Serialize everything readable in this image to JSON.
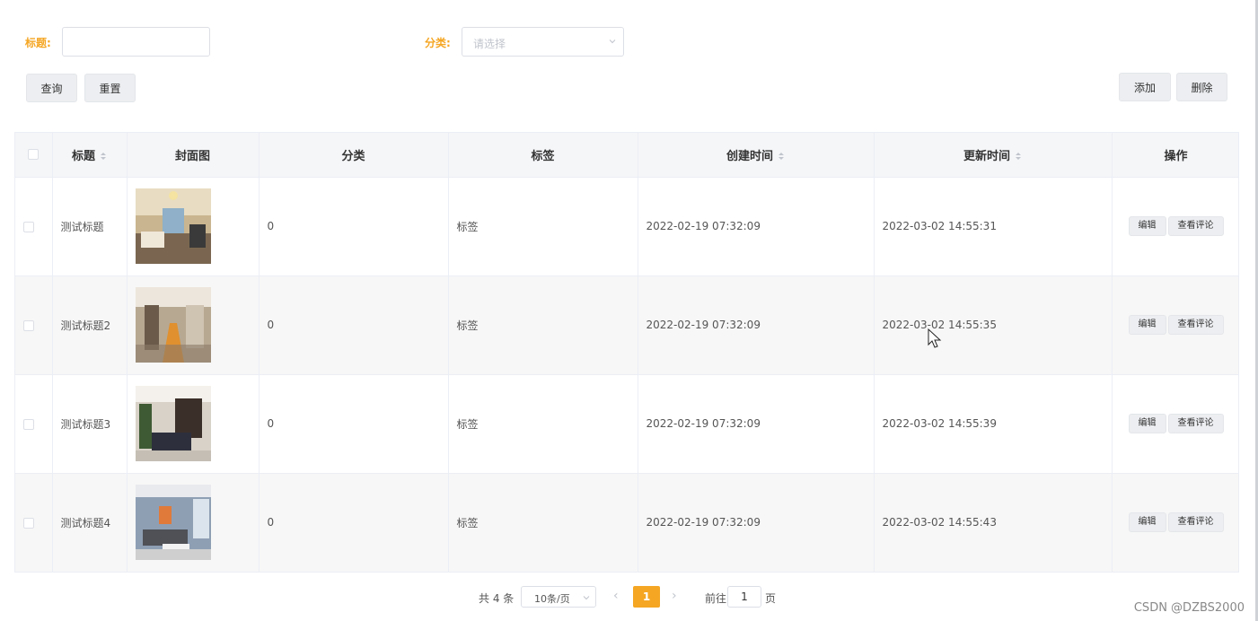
{
  "filters": {
    "title_label": "标题:",
    "category_label": "分类:",
    "category_placeholder": "请选择"
  },
  "buttons": {
    "search": "查询",
    "reset": "重置",
    "add": "添加",
    "delete": "删除"
  },
  "table": {
    "headers": [
      "标题",
      "封面图",
      "分类",
      "标签",
      "创建时间",
      "更新时间",
      "操作"
    ],
    "rows": [
      {
        "title": "测试标题",
        "category": "0",
        "tag": "标签",
        "created": "2022-02-19 07:32:09",
        "updated": "2022-03-02 14:55:31"
      },
      {
        "title": "测试标题2",
        "category": "0",
        "tag": "标签",
        "created": "2022-02-19 07:32:09",
        "updated": "2022-03-02 14:55:35"
      },
      {
        "title": "测试标题3",
        "category": "0",
        "tag": "标签",
        "created": "2022-02-19 07:32:09",
        "updated": "2022-03-02 14:55:39"
      },
      {
        "title": "测试标题4",
        "category": "0",
        "tag": "标签",
        "created": "2022-02-19 07:32:09",
        "updated": "2022-03-02 14:55:43"
      }
    ],
    "row_actions": {
      "edit": "编辑",
      "comments": "查看评论"
    }
  },
  "pagination": {
    "total": "共 4 条",
    "page_size": "10条/页",
    "current_page": "1",
    "goto_label": "前往",
    "goto_value": "1",
    "goto_unit": "页"
  },
  "watermark": "CSDN @DZBS2000",
  "colors": {
    "accent": "#f5a623",
    "border": "#ebeef5",
    "header_bg": "#f5f6f8"
  }
}
